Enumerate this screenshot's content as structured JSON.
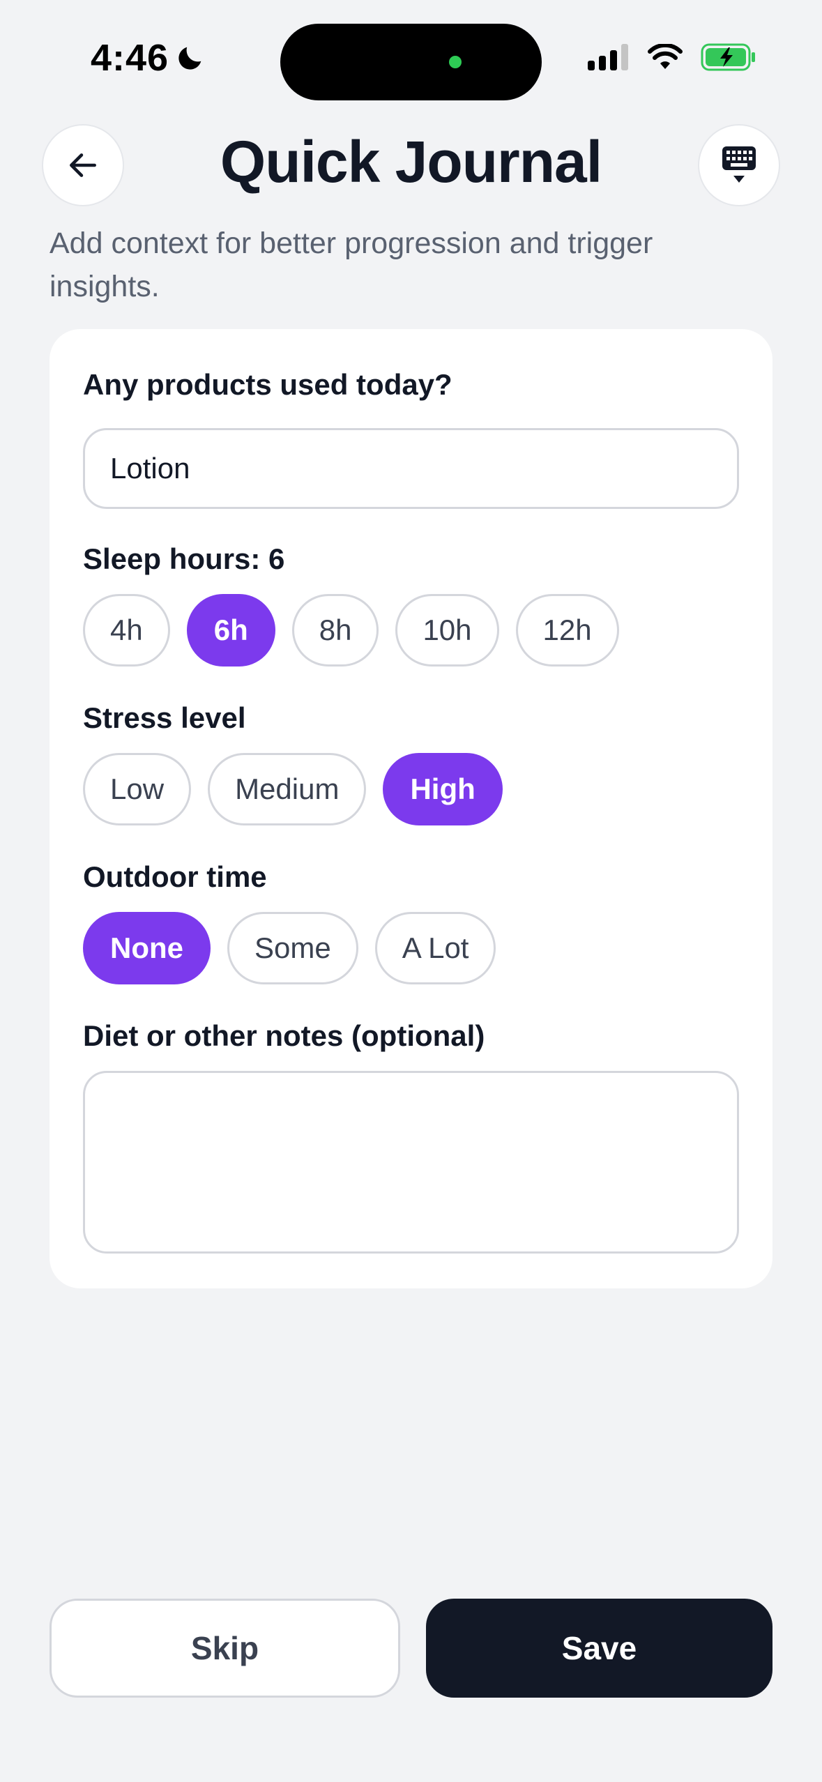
{
  "status_bar": {
    "time": "4:46",
    "icons": [
      "moon-icon",
      "cellular-signal-icon",
      "wifi-icon",
      "battery-charging-icon"
    ],
    "battery_color": "#34c759"
  },
  "header": {
    "title": "Quick Journal",
    "back_icon": "arrow-left-icon",
    "keyboard_icon": "keyboard-dismiss-icon"
  },
  "subtitle": "Add context for better progression and trigger insights.",
  "form": {
    "products": {
      "label": "Any products used today?",
      "value": "Lotion"
    },
    "sleep": {
      "label": "Sleep hours: 6",
      "options": [
        "4h",
        "6h",
        "8h",
        "10h",
        "12h"
      ],
      "selected": "6h"
    },
    "stress": {
      "label": "Stress level",
      "options": [
        "Low",
        "Medium",
        "High"
      ],
      "selected": "High"
    },
    "outdoor": {
      "label": "Outdoor time",
      "options": [
        "None",
        "Some",
        "A Lot"
      ],
      "selected": "None"
    },
    "notes": {
      "label": "Diet or other notes (optional)",
      "value": ""
    }
  },
  "actions": {
    "skip_label": "Skip",
    "save_label": "Save"
  },
  "colors": {
    "accent": "#7c3aed",
    "primary_dark": "#121826",
    "background": "#f2f3f5"
  }
}
